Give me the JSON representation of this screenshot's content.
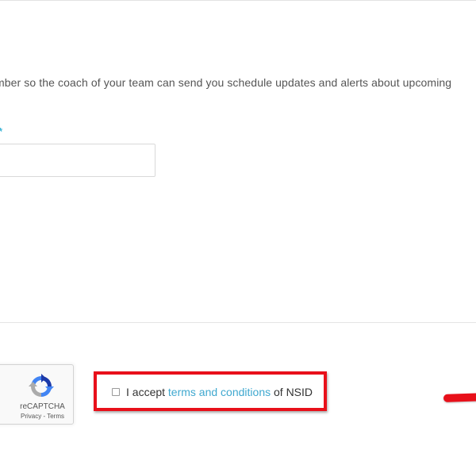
{
  "form": {
    "description": "mber so the coach of your team can send you schedule updates and alerts about upcoming",
    "required_marker": "*",
    "phone_value": ""
  },
  "recaptcha": {
    "label": "reCAPTCHA",
    "privacy": "Privacy",
    "separator": " - ",
    "terms": "Terms"
  },
  "terms": {
    "prefix": "I accept ",
    "link_text": "terms and conditions",
    "suffix": " of NSID",
    "checked": false
  },
  "colors": {
    "accent": "#3fa8cf",
    "highlight_red": "#e8101a",
    "divider": "#e4e4e4"
  }
}
